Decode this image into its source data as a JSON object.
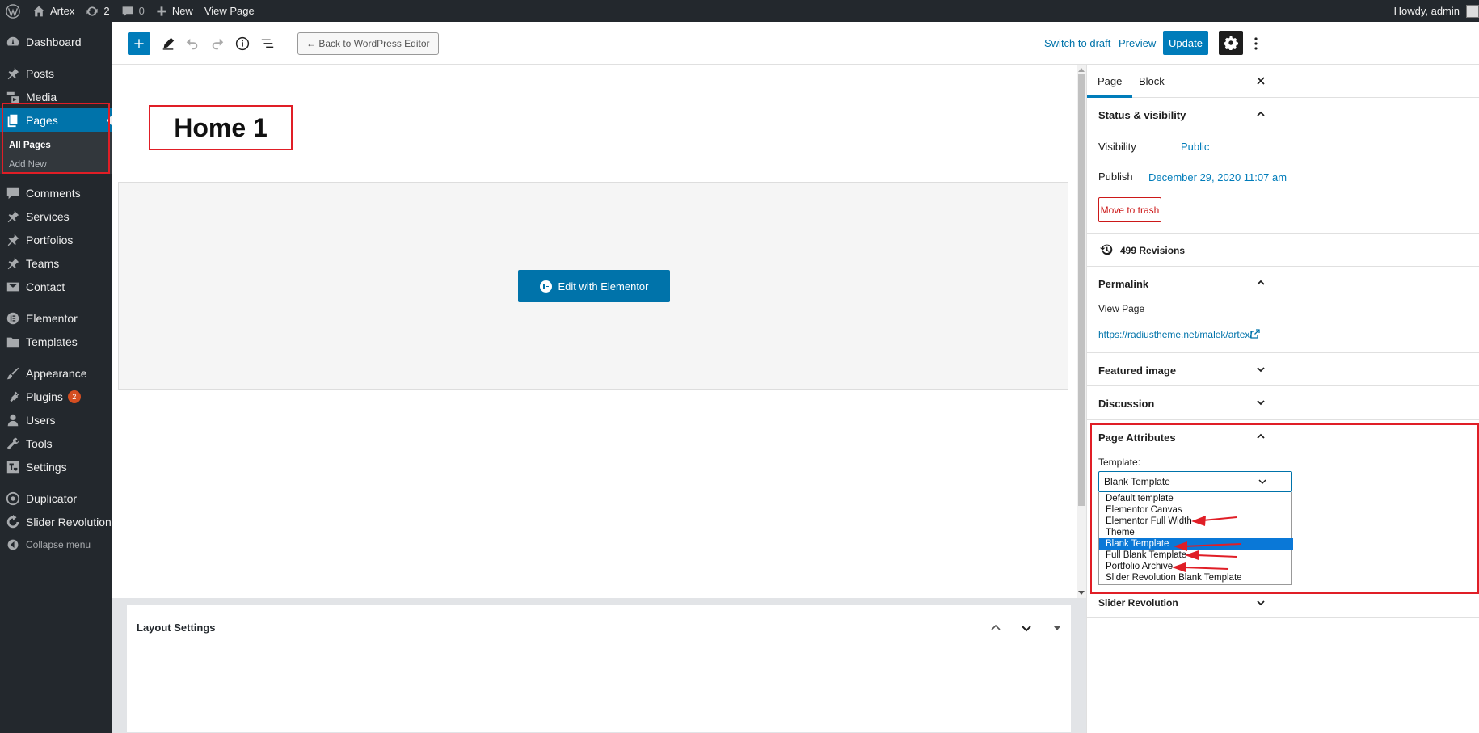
{
  "admin_bar": {
    "site_name": "Artex",
    "updates_count": "2",
    "comments_count": "0",
    "new_label": "New",
    "view_page_label": "View Page",
    "howdy": "Howdy, admin"
  },
  "sidebar": {
    "items": [
      {
        "label": "Dashboard",
        "icon": "dashboard-icon"
      },
      {
        "label": "Posts",
        "icon": "pin-icon"
      },
      {
        "label": "Media",
        "icon": "media-icon"
      },
      {
        "label": "Pages",
        "icon": "pages-icon"
      },
      {
        "label": "Comments",
        "icon": "comment-icon"
      },
      {
        "label": "Services",
        "icon": "pin-icon"
      },
      {
        "label": "Portfolios",
        "icon": "pin-icon"
      },
      {
        "label": "Teams",
        "icon": "pin-icon"
      },
      {
        "label": "Contact",
        "icon": "mail-icon"
      },
      {
        "label": "Elementor",
        "icon": "elementor-icon"
      },
      {
        "label": "Templates",
        "icon": "folder-icon"
      },
      {
        "label": "Appearance",
        "icon": "brush-icon"
      },
      {
        "label": "Plugins",
        "icon": "plugin-icon",
        "badge": "2"
      },
      {
        "label": "Users",
        "icon": "user-icon"
      },
      {
        "label": "Tools",
        "icon": "wrench-icon"
      },
      {
        "label": "Settings",
        "icon": "settings-icon"
      },
      {
        "label": "Duplicator",
        "icon": "duplicator-icon"
      },
      {
        "label": "Slider Revolution",
        "icon": "refresh-icon"
      }
    ],
    "submenu": [
      "All Pages",
      "Add New"
    ],
    "collapse_label": "Collapse menu"
  },
  "editor_header": {
    "back_label": "← Back to WordPress Editor",
    "switch_to_draft": "Switch to draft",
    "preview": "Preview",
    "update": "Update"
  },
  "canvas": {
    "page_title": "Home 1",
    "edit_with_elementor": "Edit with Elementor"
  },
  "metabox": {
    "layout_settings": "Layout Settings"
  },
  "panel": {
    "tabs": [
      "Page",
      "Block"
    ],
    "status_visibility": "Status & visibility",
    "visibility_label": "Visibility",
    "visibility_value": "Public",
    "publish_label": "Publish",
    "publish_value": "December 29, 2020 11:07 am",
    "move_to_trash": "Move to trash",
    "revisions": "499 Revisions",
    "permalink": "Permalink",
    "view_page": "View Page",
    "permalink_url": "https://radiustheme.net/malek/artex/",
    "featured_image": "Featured image",
    "discussion": "Discussion",
    "page_attributes": "Page Attributes",
    "template_label": "Template:",
    "template_selected": "Blank Template",
    "template_options": [
      "Default template",
      "Elementor Canvas",
      "Elementor Full Width",
      "Theme",
      "Blank Template",
      "Full Blank Template",
      "Portfolio Archive",
      "Slider Revolution Blank Template"
    ],
    "slider_revolution": "Slider Revolution"
  },
  "colors": {
    "admin_dark": "#23282d",
    "wp_blue": "#0073aa",
    "highlight_red": "#e01e26"
  }
}
